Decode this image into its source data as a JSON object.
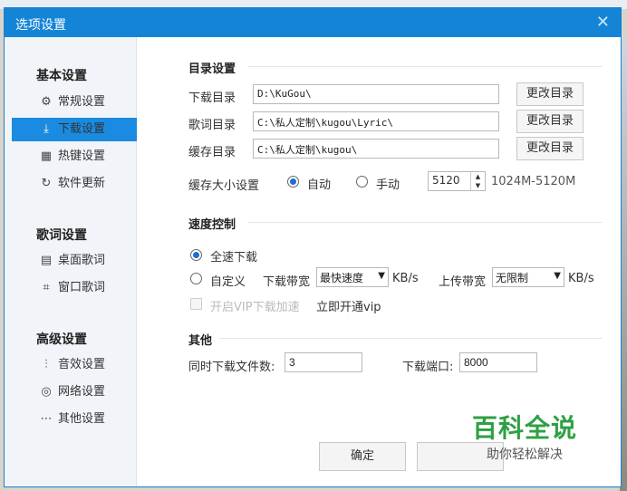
{
  "window": {
    "title": "选项设置",
    "close_glyph": "✕"
  },
  "sidebar": {
    "groups": [
      {
        "heading": "基本设置",
        "items": [
          {
            "label": "常规设置",
            "icon": "gear-icon",
            "glyph": "⚙"
          },
          {
            "label": "下载设置",
            "icon": "download-icon",
            "glyph": "⤓",
            "active": true
          },
          {
            "label": "热键设置",
            "icon": "keyboard-icon",
            "glyph": "▦"
          },
          {
            "label": "软件更新",
            "icon": "update-icon",
            "glyph": "↻"
          }
        ]
      },
      {
        "heading": "歌词设置",
        "items": [
          {
            "label": "桌面歌词",
            "icon": "desktop-lyric-icon",
            "glyph": "▤"
          },
          {
            "label": "窗口歌词",
            "icon": "window-lyric-icon",
            "glyph": "⌗"
          }
        ]
      },
      {
        "heading": "高级设置",
        "items": [
          {
            "label": "音效设置",
            "icon": "equalizer-icon",
            "glyph": "⫶"
          },
          {
            "label": "网络设置",
            "icon": "network-icon",
            "glyph": "◎"
          },
          {
            "label": "其他设置",
            "icon": "more-icon",
            "glyph": "⋯"
          }
        ]
      }
    ]
  },
  "directory": {
    "section_title": "目录设置",
    "rows": [
      {
        "label": "下载目录",
        "value": "D:\\KuGou\\",
        "button": "更改目录"
      },
      {
        "label": "歌词目录",
        "value": "C:\\私人定制\\kugou\\Lyric\\",
        "button": "更改目录"
      },
      {
        "label": "缓存目录",
        "value": "C:\\私人定制\\kugou\\",
        "button": "更改目录"
      }
    ],
    "cache_size_label": "缓存大小设置",
    "cache_auto_label": "自动",
    "cache_manual_label": "手动",
    "cache_mode": "自动",
    "cache_value": "5120",
    "cache_range": "1024M-5120M"
  },
  "speed": {
    "section_title": "速度控制",
    "full_speed_label": "全速下载",
    "custom_label": "自定义",
    "download_bw_label": "下载带宽",
    "download_bw_value": "最快速度",
    "upload_bw_label": "上传带宽",
    "upload_bw_value": "无限制",
    "unit": "KB/s",
    "mode": "全速下载",
    "vip_checkbox_label": "开启VIP下载加速",
    "vip_link": "立即开通vip"
  },
  "other": {
    "section_title": "其他",
    "concurrent_label": "同时下载文件数:",
    "concurrent_value": "3",
    "port_label": "下载端口:",
    "port_value": "8000"
  },
  "footer": {
    "ok_label": "确定"
  },
  "watermark": {
    "big": "百科全说",
    "small": "助你轻松解决"
  },
  "colors": {
    "accent": "#1485d6",
    "active_item": "#1a8be0",
    "watermark_green": "#2ea043"
  }
}
